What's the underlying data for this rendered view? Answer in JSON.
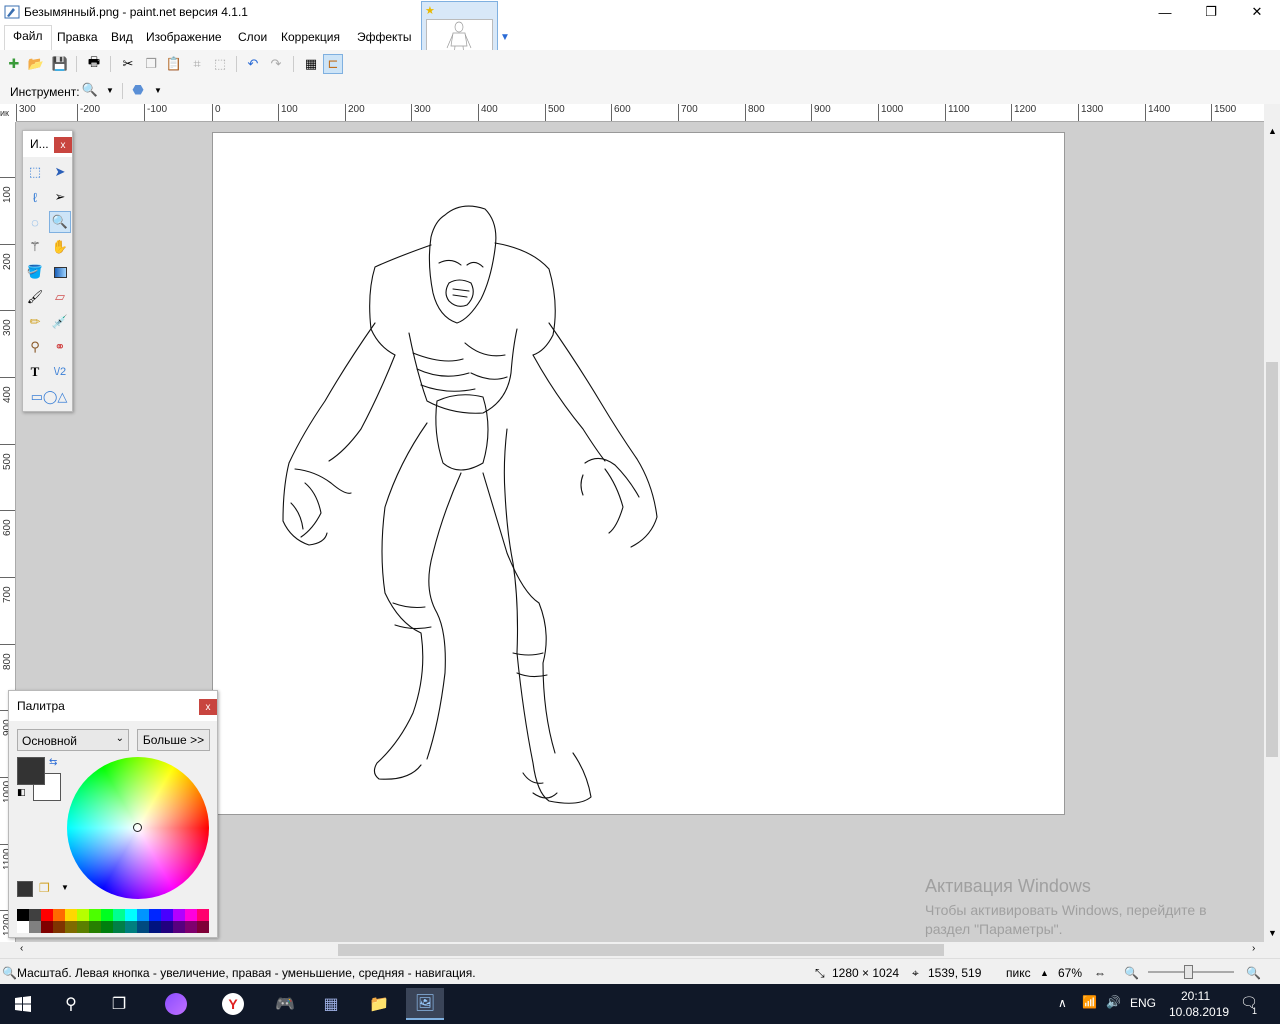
{
  "window": {
    "title": "Безымянный.png - paint.net версия 4.1.1",
    "minimize_glyph": "—",
    "maximize_glyph": "❐",
    "close_glyph": "✕"
  },
  "menu": {
    "items": [
      "Файл",
      "Правка",
      "Вид",
      "Изображение",
      "Слои",
      "Коррекция",
      "Эффекты"
    ]
  },
  "tool_options": {
    "label": "Инструмент:"
  },
  "ruler": {
    "corner": "ик",
    "h_ticks": [
      "300",
      "-200",
      "-100",
      "0",
      "100",
      "200",
      "300",
      "400",
      "500",
      "600",
      "700",
      "800",
      "900",
      "1000",
      "1100",
      "1200",
      "1300",
      "1400",
      "1500"
    ],
    "v_ticks": [
      "100",
      "200",
      "300",
      "400",
      "500",
      "600",
      "700",
      "800",
      "900",
      "1000",
      "1100",
      "1200"
    ]
  },
  "tools_window": {
    "title": "И...",
    "close": "x"
  },
  "palette": {
    "title": "Палитра",
    "close": "x",
    "mode": "Основной",
    "more_button": "Больше >>",
    "primary_color": "#333333",
    "secondary_color": "#ffffff",
    "colors_top": [
      "#000000",
      "#404040",
      "#ff0000",
      "#ff6a00",
      "#ffd800",
      "#b6ff00",
      "#4cff00",
      "#00ff21",
      "#00ff90",
      "#00ffff",
      "#0094ff",
      "#0026ff",
      "#4800ff",
      "#b200ff",
      "#ff00dc",
      "#ff006e"
    ],
    "colors_bottom": [
      "#ffffff",
      "#808080",
      "#7f0000",
      "#7f3300",
      "#7f6a00",
      "#5b7f00",
      "#267f00",
      "#007f0e",
      "#007f46",
      "#007f7f",
      "#004a7f",
      "#00137f",
      "#21007f",
      "#57007f",
      "#7f006e",
      "#7f0037"
    ]
  },
  "watermark": {
    "line1": "Активация Windows",
    "line2": "Чтобы активировать Windows, перейдите в раздел \"Параметры\"."
  },
  "status": {
    "hint": "Масштаб. Левая кнопка - увеличение, правая - уменьшение, средняя - навигация.",
    "image_size": "1280 × 1024",
    "cursor_pos": "1539, 519",
    "units": "пикс",
    "zoom": "67%"
  },
  "taskbar": {
    "lang": "ENG",
    "time": "20:11",
    "date": "10.08.2019",
    "notification_count": "1"
  }
}
